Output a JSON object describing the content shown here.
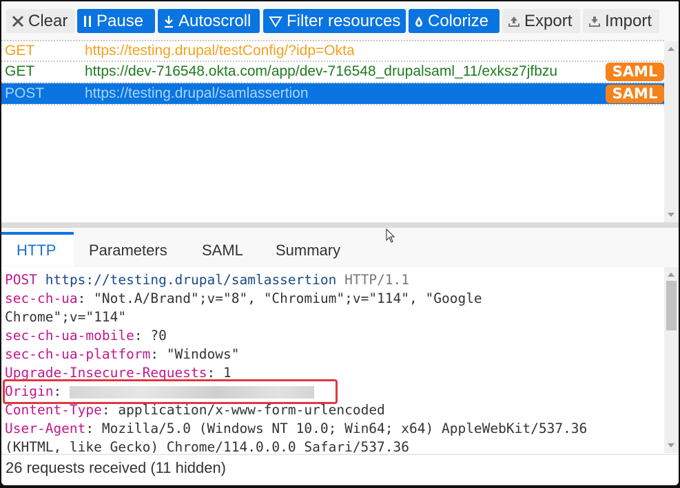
{
  "toolbar": {
    "buttons": [
      {
        "label": "Clear",
        "icon": "close-icon",
        "style": "gray"
      },
      {
        "label": "Pause",
        "icon": "pause-icon",
        "style": "blue"
      },
      {
        "label": "Autoscroll",
        "icon": "download-arrow-icon",
        "style": "blue"
      },
      {
        "label": "Filter resources",
        "icon": "filter-icon",
        "style": "blue"
      },
      {
        "label": "Colorize",
        "icon": "drop-icon",
        "style": "blue"
      },
      {
        "label": "Export",
        "icon": "export-icon",
        "style": "gray"
      },
      {
        "label": "Import",
        "icon": "import-icon",
        "style": "gray"
      }
    ]
  },
  "requests": [
    {
      "method": "GET",
      "url": "https://testing.drupal/testConfig/?idp=Okta",
      "color": "#f5a021",
      "badge": null,
      "selected": false
    },
    {
      "method": "GET",
      "url": "https://dev-716548.okta.com/app/dev-716548_drupalsaml_11/exksz7jfbzu",
      "color": "#1f7a1f",
      "badge": "SAML",
      "selected": false
    },
    {
      "method": "POST",
      "url": "https://testing.drupal/samlassertion",
      "color": "#a9d4ff",
      "badge": "SAML",
      "selected": true
    }
  ],
  "tabs": [
    {
      "label": "HTTP",
      "active": true
    },
    {
      "label": "Parameters",
      "active": false
    },
    {
      "label": "SAML",
      "active": false
    },
    {
      "label": "Summary",
      "active": false
    }
  ],
  "http": {
    "request_line": {
      "method": "POST",
      "url": "https://testing.drupal/samlassertion",
      "version": "HTTP/1.1"
    },
    "headers": [
      {
        "name": "sec-ch-ua",
        "value": "\"Not.A/Brand\";v=\"8\", \"Chromium\";v=\"114\", \"Google\nChrome\";v=\"114\""
      },
      {
        "name": "sec-ch-ua-mobile",
        "value": "?0"
      },
      {
        "name": "sec-ch-ua-platform",
        "value": "\"Windows\""
      },
      {
        "name": "Upgrade-Insecure-Requests",
        "value": "1"
      },
      {
        "name": "Origin",
        "value": "",
        "redacted": true,
        "highlighted": true
      },
      {
        "name": "Content-Type",
        "value": "application/x-www-form-urlencoded"
      },
      {
        "name": "User-Agent",
        "value": "Mozilla/5.0 (Windows NT 10.0; Win64; x64) AppleWebKit/537.36\n(KHTML, like Gecko) Chrome/114.0.0.0 Safari/537.36"
      }
    ]
  },
  "status": {
    "text": "26 requests received (11 hidden)"
  },
  "colors": {
    "accent": "#0a74e0",
    "saml_badge": "#f7821b",
    "header_name": "#c0188c",
    "highlight_box": "#e0383e"
  }
}
